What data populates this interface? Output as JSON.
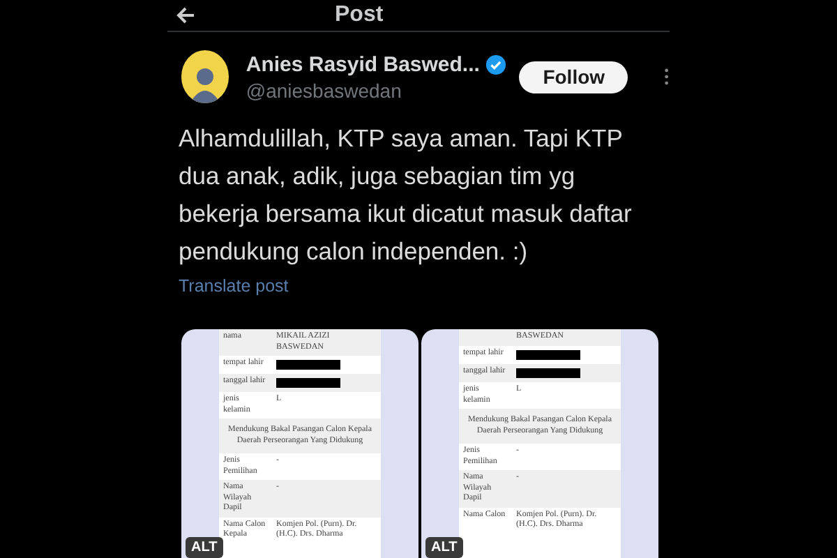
{
  "header": {
    "title": "Post"
  },
  "author": {
    "name": "Anies Rasyid Baswed...",
    "handle": "@aniesbaswedan",
    "verified": true,
    "follow_label": "Follow"
  },
  "text": "Alhamdulillah, KTP saya aman. Tapi KTP dua anak, adik, juga sebagian tim yg bekerja bersama ikut dicatut masuk daftar pendukung calon independen. :)",
  "translate": "Translate post",
  "media": [
    {
      "alt": "ALT",
      "rows": [
        {
          "kind": "pair",
          "label": "nama",
          "value": "MIKAIL AZIZI BASWEDAN"
        },
        {
          "kind": "pair",
          "label": "tempat lahir",
          "redacted": true
        },
        {
          "kind": "pair",
          "label": "tanggal lahir",
          "redacted": true
        },
        {
          "kind": "pair",
          "label": "jenis kelamin",
          "value": "L"
        },
        {
          "kind": "heading",
          "text": "Mendukung Bakal Pasangan Calon Kepala Daerah Perseorangan Yang Didukung"
        },
        {
          "kind": "pair",
          "label": "Jenis Pemilihan",
          "value": "-"
        },
        {
          "kind": "pair",
          "label": "Nama Wilayah Dapil",
          "value": "-"
        },
        {
          "kind": "pair",
          "label": "Nama Calon Kepala",
          "value": "Komjen Pol. (Purn). Dr. (H.C). Drs. Dharma"
        }
      ]
    },
    {
      "alt": "ALT",
      "rows": [
        {
          "kind": "value",
          "value": "BASWEDAN"
        },
        {
          "kind": "pair",
          "label": "tempat lahir",
          "redacted": true
        },
        {
          "kind": "pair",
          "label": "tanggal lahir",
          "redacted": true
        },
        {
          "kind": "pair",
          "label": "jenis kelamin",
          "value": "L"
        },
        {
          "kind": "heading",
          "text": "Mendukung Bakal Pasangan Calon Kepala Daerah Perseorangan Yang Didukung"
        },
        {
          "kind": "pair",
          "label": "Jenis Pemilihan",
          "value": "-"
        },
        {
          "kind": "pair",
          "label": "Nama Wilayah Dapil",
          "value": "-"
        },
        {
          "kind": "pair",
          "label": "Nama Calon",
          "value": "Komjen Pol. (Purn). Dr. (H.C). Drs. Dharma"
        }
      ]
    }
  ]
}
